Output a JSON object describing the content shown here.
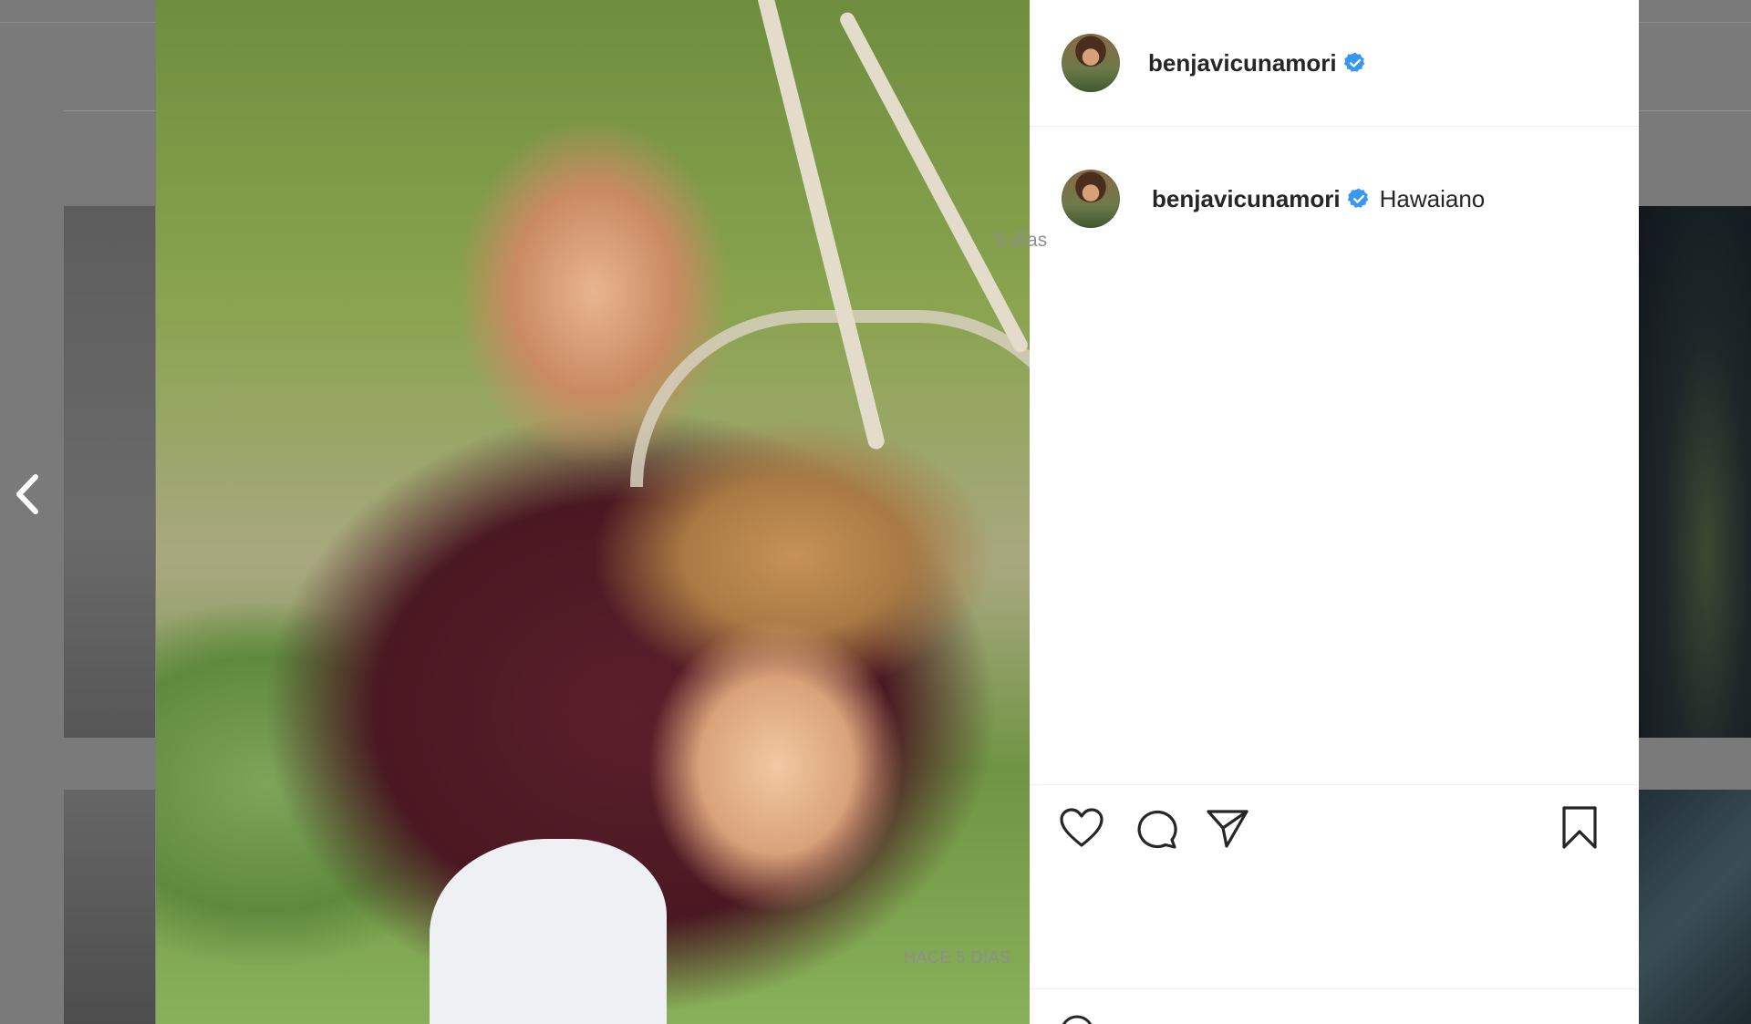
{
  "post": {
    "author": {
      "username": "benjavicunamori",
      "verified": true
    },
    "caption": {
      "username": "benjavicunamori",
      "text": "Hawaiano",
      "relative_time": "5 días"
    },
    "date_label": "HACE 5 DÍAS"
  },
  "icons": {
    "verified": "verified-badge-icon",
    "prev": "chevron-left-icon",
    "like": "heart-icon",
    "comment": "comment-bubble-icon",
    "share": "paper-plane-icon",
    "save": "bookmark-icon",
    "emoji": "smiley-icon"
  },
  "colors": {
    "verified_blue": "#3897f0",
    "text": "#262626",
    "muted": "#8e8e8e"
  }
}
